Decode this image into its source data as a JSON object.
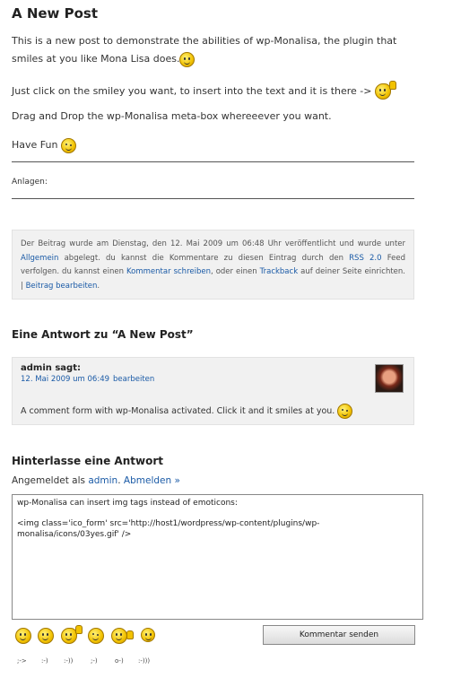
{
  "post": {
    "title": "A New Post",
    "para1": "This is a new post to demonstrate the abilities of wp-Monalisa, the plugin that smiles at you like Mona Lisa does.",
    "para2": "Just click on the smiley you want, to insert into the text and it is there ->",
    "para3": "Drag and Drop the wp-Monalisa meta-box whereeever you want.",
    "para4": "Have Fun",
    "attachments_label": "Anlagen:"
  },
  "meta": {
    "text_a": "Der Beitrag wurde am Dienstag, den 12. Mai 2009 um 06:48 Uhr veröffentlicht und wurde unter ",
    "category": "Allgemein",
    "text_b": " abgelegt. du kannst die Kommentare zu diesen Eintrag durch den ",
    "rss": "RSS 2.0",
    "text_c": " Feed verfolgen. du kannst einen ",
    "comment_link": "Kommentar schreiben",
    "text_d": ", oder einen ",
    "trackback": "Trackback",
    "text_e": " auf deiner Seite einrichten. | ",
    "edit_link": "Beitrag bearbeiten",
    "text_f": "."
  },
  "comments": {
    "title": "Eine Antwort zu “A New Post”",
    "items": [
      {
        "author": "admin sagt:",
        "date": "12. Mai 2009 um 06:49",
        "edit": "bearbeiten",
        "text": "A comment form with wp-Monalisa activated. Click it and it smiles at you."
      }
    ]
  },
  "reply": {
    "title": "Hinterlasse eine Antwort",
    "logged_prefix": "Angemeldet als ",
    "user": "admin",
    "logout": "Abmelden »",
    "textarea_value": "wp-Monalisa can insert img tags instead of emoticons:\n\n<img class='ico_form' src='http://host1/wordpress/wp-content/plugins/wp-monalisa/icons/03yes.gif' />",
    "submit": "Kommentar senden"
  },
  "emoticons": [
    {
      "icon": "cross-eyed-smiley-icon",
      "code": ";->"
    },
    {
      "icon": "smiley-icon",
      "code": ":-)"
    },
    {
      "icon": "thumbs-up-smiley-icon",
      "code": ":-))"
    },
    {
      "icon": "wink-smiley-icon",
      "code": ";-)"
    },
    {
      "icon": "waving-smiley-icon",
      "code": "o-)"
    },
    {
      "icon": "big-smile-icon",
      "code": ":-)))"
    }
  ],
  "colors": {
    "link": "#1a5aa6",
    "meta_bg": "#f1f1f1",
    "smiley": "#f2c200"
  }
}
